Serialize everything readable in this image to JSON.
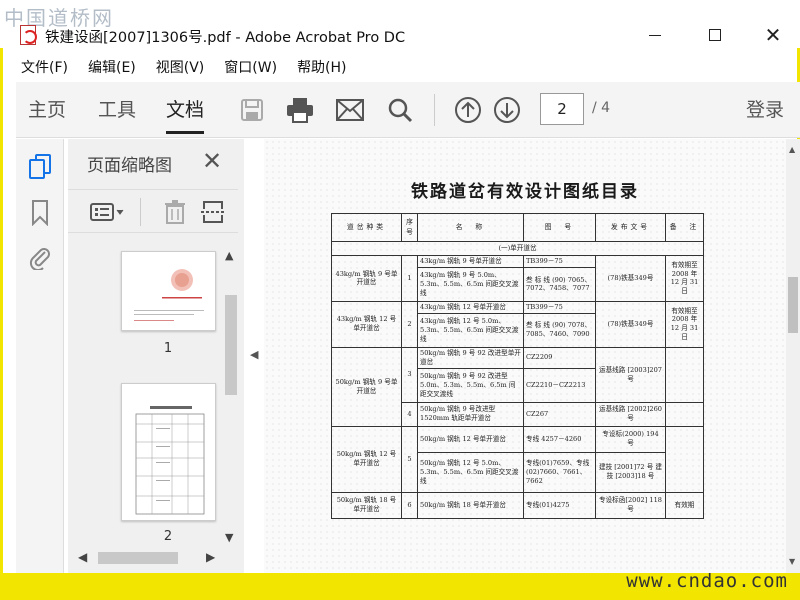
{
  "window": {
    "watermark": "中国道桥网",
    "title": "铁建设函[2007]1306号.pdf - Adobe Acrobat Pro DC",
    "min": "",
    "max": "",
    "close": "✕"
  },
  "menu": [
    "文件(F)",
    "编辑(E)",
    "视图(V)",
    "窗口(W)",
    "帮助(H)"
  ],
  "toolbar": {
    "tabs": [
      "主页",
      "工具",
      "文档"
    ],
    "active_tab": "文档",
    "current_page": "2",
    "total_pages": "/ 4",
    "login": "登录"
  },
  "thumbnails": {
    "title": "页面缩略图",
    "close": "✕",
    "pages": [
      "1",
      "2"
    ]
  },
  "document": {
    "title": "铁路道岔有效设计图纸目录",
    "headers": [
      "道岔种类",
      "序号",
      "名　称",
      "图　号",
      "发布文号",
      "备　注"
    ],
    "section": "(一)单开道岔",
    "rows": [
      {
        "kind": "43kg/m 钢轨 9 号单开道岔",
        "no": "1",
        "names": [
          "43kg/m 钢轨 9 号单开道岔",
          "43kg/m 钢轨 9 号 5.0m、5.3m、5.5m、6.5m 间距交叉渡线"
        ],
        "figures": [
          "TB399－75",
          "叁 标 线 (90) 7065、7072、7458、7077"
        ],
        "doc": "(78)铁基349号",
        "note": "有效期至 2008 年 12 月 31 日"
      },
      {
        "kind": "43kg/m 钢轨 12 号单开道岔",
        "no": "2",
        "names": [
          "43kg/m 钢轨 12 号单开道岔",
          "43kg/m 钢轨 12 号 5.0m、5.3m、5.5m、6.5m 间距交叉渡线"
        ],
        "figures": [
          "TB399－75",
          "叁 标 线 (90) 7078、7085、7460、7090"
        ],
        "doc": "(78)铁基349号",
        "note": "有效期至 2008 年 12 月 31 日"
      },
      {
        "kind": "50kg/m 钢轨 9 号单开道岔",
        "no": "3",
        "names": [
          "50kg/m 钢轨 9 号 92 改进型单开道岔",
          "50kg/m 钢轨 9 号 92 改进型 5.0m、5.3m、5.5m、6.5m 间距交叉渡线"
        ],
        "figures": [
          "CZ2209",
          "CZ2210－CZ2213"
        ],
        "doc": "运基线路 [2003]207 号",
        "note": ""
      },
      {
        "kind": "",
        "no": "4",
        "names": [
          "50kg/m 钢轨 9 号改进型 1520mm 轨距单开道岔"
        ],
        "figures": [
          "CZ267"
        ],
        "doc": "运基线路 [2002]260 号",
        "note": ""
      },
      {
        "kind": "50kg/m 钢轨 12 号单开道岔",
        "no": "5",
        "names": [
          "50kg/m 钢轨 12 号单开道岔",
          "50kg/m 钢轨 12 号 5.0m、5.3m、5.5m、6.5m 间距交叉渡线"
        ],
        "figures": [
          "专线 4257－4260",
          "专线(01)7659、专线(02)7660、7661、7662"
        ],
        "doc_a": "专设标(2000) 194 号",
        "doc_b": "建技 [2001]72 号 建技 [2003]18 号",
        "note": ""
      },
      {
        "kind": "50kg/m 钢轨 18 号单开道岔",
        "no": "6",
        "names": [
          "50kg/m 钢轨 18 号单开道岔"
        ],
        "figures": [
          "专线(01)4275"
        ],
        "doc": "专设标函[2002] 118 号",
        "note": "有效期"
      }
    ]
  },
  "bottom_watermark": "www.cndao.com"
}
